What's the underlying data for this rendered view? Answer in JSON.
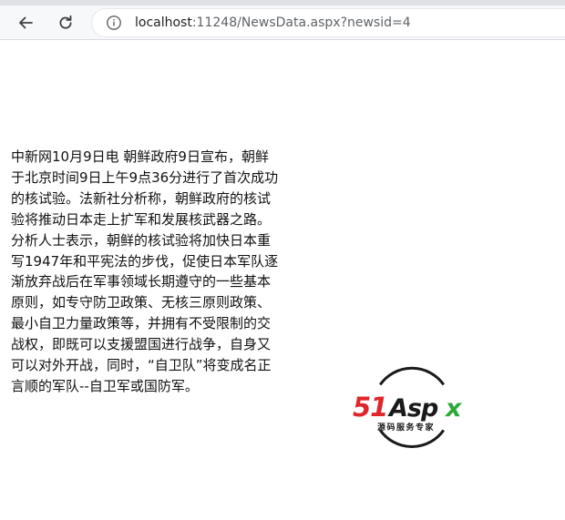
{
  "browser": {
    "url_host": "localhost",
    "url_rest": ":11248/NewsData.aspx?newsid=4",
    "icons": {
      "back": "arrow-left-icon",
      "reload": "reload-icon",
      "info": "info-icon"
    }
  },
  "article": {
    "text": "中新网10月9日电 朝鲜政府9日宣布，朝鲜于北京时间9日上午9点36分进行了首次成功的核试验。法新社分析称，朝鲜政府的核试验将推动日本走上扩军和发展核武器之路。        分析人士表示，朝鲜的核试验将加快日本重写1947年和平宪法的步伐，促使日本军队逐渐放弃战后在军事领域长期遵守的一些基本原则，如专守防卫政策、无核三原则政策、最小自卫力量政策等，并拥有不受限制的交战权，即既可以支援盟国进行战争，自身又可以对外开战，同时，“自卫队”将变成名正言顺的军队--自卫军或国防军。"
  },
  "logo": {
    "brand": "51Aspx",
    "tagline": "源码服务专家",
    "colors": {
      "red": "#e0262b",
      "black": "#1a1a1a",
      "green": "#2ea83a"
    }
  }
}
